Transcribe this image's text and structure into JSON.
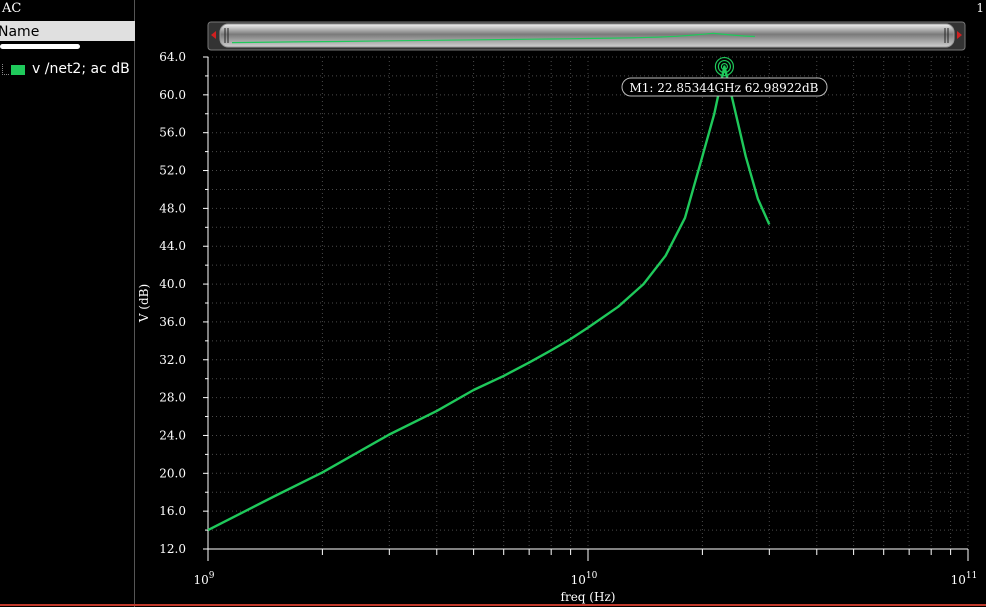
{
  "window": {
    "tab_title": "AC",
    "corner_label": "1"
  },
  "left_panel": {
    "header": "Name",
    "legend_label": "v /net2; ac dB"
  },
  "colors": {
    "trace": "#1fc95b",
    "grid": "#4a4a4a",
    "background": "#000000"
  },
  "marker": {
    "label": "M1: 22.85344GHz 62.98922dB",
    "x": 22853440000,
    "y": 62.98922
  },
  "icons": [
    "scroll-left-arrow-icon",
    "scroll-right-arrow-icon",
    "marker-target-icon"
  ],
  "chart_data": {
    "type": "line",
    "xlabel": "freq (Hz)",
    "ylabel": "V (dB)",
    "xscale": "log",
    "xlim": [
      1000000000,
      100000000000
    ],
    "ylim": [
      12.0,
      64.0
    ],
    "xticks": [
      {
        "value": 1000000000,
        "base": "10",
        "exp": "9"
      },
      {
        "value": 10000000000,
        "base": "10",
        "exp": "10"
      },
      {
        "value": 100000000000,
        "base": "10",
        "exp": "11"
      }
    ],
    "yticks": [
      "12.0",
      "16.0",
      "20.0",
      "24.0",
      "28.0",
      "32.0",
      "36.0",
      "40.0",
      "44.0",
      "48.0",
      "52.0",
      "56.0",
      "60.0",
      "64.0"
    ],
    "grid": true,
    "series": [
      {
        "name": "v /net2; ac dB",
        "x": [
          1000000000,
          1500000000,
          2000000000,
          3000000000,
          4000000000,
          5000000000,
          6000000000,
          7000000000,
          8000000000,
          9000000000,
          10000000000,
          12000000000,
          14000000000,
          16000000000,
          18000000000,
          20000000000,
          21500000000,
          22853440000,
          24000000000,
          26000000000,
          28000000000,
          30000000000
        ],
        "y": [
          14.0,
          17.6,
          20.1,
          24.1,
          26.6,
          28.8,
          30.3,
          31.7,
          33.0,
          34.2,
          35.4,
          37.6,
          40.0,
          43.0,
          47.0,
          53.5,
          58.0,
          62.99,
          59.5,
          53.5,
          49.0,
          46.3
        ]
      }
    ]
  }
}
